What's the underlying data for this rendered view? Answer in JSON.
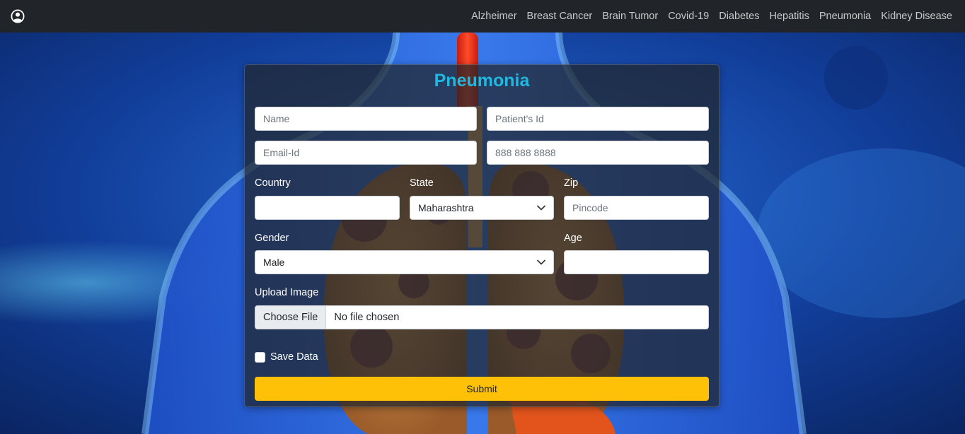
{
  "navbar": {
    "user_icon": "user-circle-icon",
    "links": [
      "Alzheimer",
      "Breast Cancer",
      "Brain Tumor",
      "Covid-19",
      "Diabetes",
      "Hepatitis",
      "Pneumonia",
      "Kidney Disease"
    ]
  },
  "form": {
    "title": "Pneumonia",
    "name_placeholder": "Name",
    "patient_id_placeholder": "Patient's Id",
    "email_placeholder": "Email-Id",
    "phone_placeholder": "888 888 8888",
    "country_label": "Country",
    "country_value": "",
    "state_label": "State",
    "state_selected": "Maharashtra",
    "zip_label": "Zip",
    "zip_placeholder": "Pincode",
    "gender_label": "Gender",
    "gender_selected": "Male",
    "age_label": "Age",
    "age_value": "",
    "upload_label": "Upload Image",
    "choose_file_label": "Choose File",
    "no_file_text": "No file chosen",
    "save_data_label": "Save Data",
    "save_data_checked": false,
    "submit_label": "Submit"
  },
  "colors": {
    "navbar_bg": "#212529",
    "title": "#20b8e0",
    "submit": "#ffc107"
  }
}
